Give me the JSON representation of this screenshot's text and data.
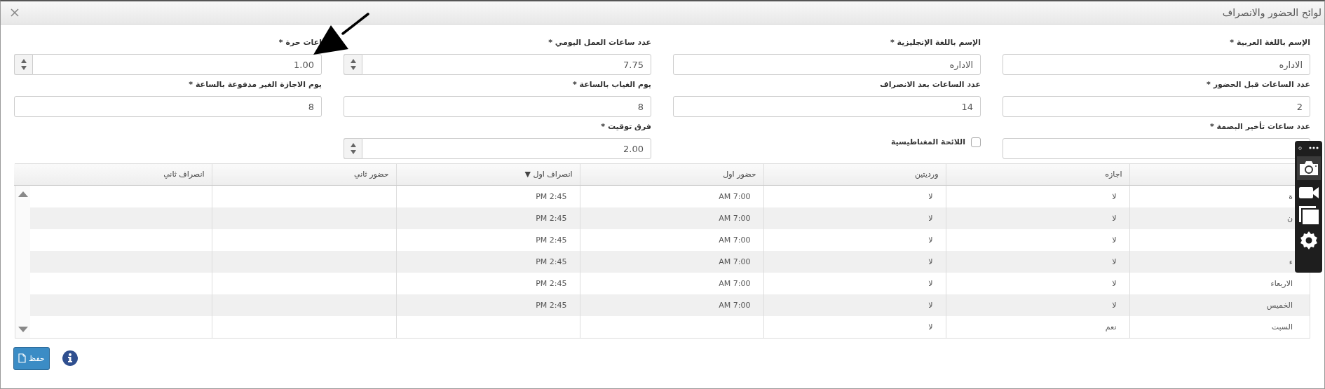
{
  "window": {
    "title": "لوائح الحضور والانصراف"
  },
  "form": {
    "fields": [
      {
        "kind": "text",
        "label": "الإسم باللغة العربية *",
        "value": "الاداره"
      },
      {
        "kind": "text",
        "label": "الإسم باللغة الإنجليزية *",
        "value": "الاداره"
      },
      {
        "kind": "spinner",
        "label": "عدد ساعات العمل اليومي *",
        "value": "7.75"
      },
      {
        "kind": "spinner",
        "label": "اعات حرة *",
        "value": "1.00"
      },
      {
        "kind": "text",
        "label": "عدد الساعات قبل الحضور *",
        "value": "2"
      },
      {
        "kind": "text",
        "label": "عدد الساعات بعد الانصراف",
        "value": "14"
      },
      {
        "kind": "text",
        "label": "يوم الغياب بالساعة *",
        "value": "8"
      },
      {
        "kind": "text",
        "label": "يوم الاجازة الغير مدفوعة بالساعة *",
        "value": "8"
      },
      {
        "kind": "text",
        "label": "عدد ساعات تأخير البصمة *"
      },
      {
        "kind": "checkbox",
        "label": "اللائحة المغناطيسية",
        "checked": false
      },
      {
        "kind": "spinner",
        "label": "فرق توقيت *",
        "value": "2.00"
      }
    ]
  },
  "table": {
    "columns": [
      {},
      {
        "label": "اجازه"
      },
      {
        "label": "ورديتين"
      },
      {
        "label": "حضور اول"
      },
      {
        "label": "انصراف اول ▼"
      },
      {
        "label": "حضور ثاني"
      },
      {
        "label": "انصراف ثاني"
      }
    ],
    "rows": [
      {
        "cells": [
          "ة",
          "لا",
          "لا",
          "AM 7:00",
          "PM 2:45",
          null,
          null
        ]
      },
      {
        "cells": [
          "ن",
          "لا",
          "لا",
          "AM 7:00",
          "PM 2:45",
          null,
          null
        ]
      },
      {
        "cells": [
          null,
          "لا",
          "لا",
          "AM 7:00",
          "PM 2:45",
          null,
          null
        ]
      },
      {
        "cells": [
          "ء",
          "لا",
          "لا",
          "AM 7:00",
          "PM 2:45",
          null,
          null
        ]
      },
      {
        "cells": [
          "الاربعاء",
          "لا",
          "لا",
          "AM 7:00",
          "PM 2:45",
          null,
          null
        ]
      },
      {
        "cells": [
          "الخميس",
          "لا",
          "لا",
          "AM 7:00",
          "PM 2:45",
          null,
          null
        ]
      },
      {
        "cells": [
          "السبت",
          "نعم",
          "لا",
          null,
          null,
          null,
          null
        ]
      }
    ]
  },
  "footer": {
    "save_button": "حفظ"
  }
}
